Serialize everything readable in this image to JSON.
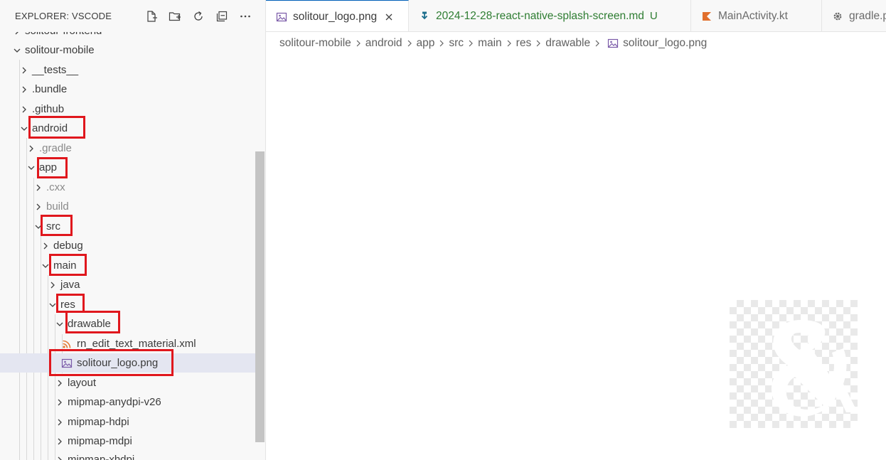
{
  "explorer": {
    "title": "EXPLORER: VSCODE",
    "actions": [
      "new-file-icon",
      "new-folder-icon",
      "refresh-icon",
      "collapse-all-icon",
      "more-icon"
    ]
  },
  "tree": {
    "items": [
      {
        "label": "solitour-frontend",
        "icon": "chevron-right-icon",
        "partially_visible": true
      },
      {
        "label": "solitour-mobile",
        "icon": "chevron-down-icon"
      },
      {
        "label": "__tests__",
        "icon": "chevron-right-icon"
      },
      {
        "label": ".bundle",
        "icon": "chevron-right-icon"
      },
      {
        "label": ".github",
        "icon": "chevron-right-icon"
      },
      {
        "label": "android",
        "icon": "chevron-down-icon",
        "highlighted": true
      },
      {
        "label": ".gradle",
        "icon": "chevron-right-icon",
        "dimmed": true
      },
      {
        "label": "app",
        "icon": "chevron-down-icon",
        "highlighted": true
      },
      {
        "label": ".cxx",
        "icon": "chevron-right-icon",
        "dimmed": true
      },
      {
        "label": "build",
        "icon": "chevron-right-icon",
        "dimmed": true
      },
      {
        "label": "src",
        "icon": "chevron-down-icon",
        "highlighted": true
      },
      {
        "label": "debug",
        "icon": "chevron-right-icon"
      },
      {
        "label": "main",
        "icon": "chevron-down-icon",
        "highlighted": true
      },
      {
        "label": "java",
        "icon": "chevron-right-icon"
      },
      {
        "label": "res",
        "icon": "chevron-down-icon",
        "highlighted": true
      },
      {
        "label": "drawable",
        "icon": "chevron-down-icon",
        "highlighted": true
      },
      {
        "label": "rn_edit_text_material.xml",
        "icon": "rss-icon"
      },
      {
        "label": "solitour_logo.png",
        "icon": "image-icon",
        "highlighted": true,
        "selected": true
      },
      {
        "label": "layout",
        "icon": "chevron-right-icon"
      },
      {
        "label": "mipmap-anydpi-v26",
        "icon": "chevron-right-icon"
      },
      {
        "label": "mipmap-hdpi",
        "icon": "chevron-right-icon"
      },
      {
        "label": "mipmap-mdpi",
        "icon": "chevron-right-icon"
      },
      {
        "label": "mipmap-xhdpi",
        "icon": "chevron-right-icon",
        "partially_visible": true
      }
    ],
    "highlight_color": "#e0171d",
    "selected_color": "#e4e6f1"
  },
  "tabs": [
    {
      "label": "solitour_logo.png",
      "icon": "image-icon",
      "active": true,
      "closable": true
    },
    {
      "label": "2024-12-28-react-native-splash-screen.md",
      "icon": "markdown-download-icon",
      "badge": "U",
      "color": "#2e7d32"
    },
    {
      "label": "MainActivity.kt",
      "icon": "kotlin-icon"
    },
    {
      "label": "gradle.p",
      "icon": "gear-icon",
      "truncated": true
    }
  ],
  "breadcrumb": {
    "items": [
      "solitour-mobile",
      "android",
      "app",
      "src",
      "main",
      "res",
      "drawable"
    ],
    "file": "solitour_logo.png",
    "file_icon": "image-icon"
  },
  "preview": {
    "file": "solitour_logo.png",
    "background": "transparency-checkerboard"
  }
}
